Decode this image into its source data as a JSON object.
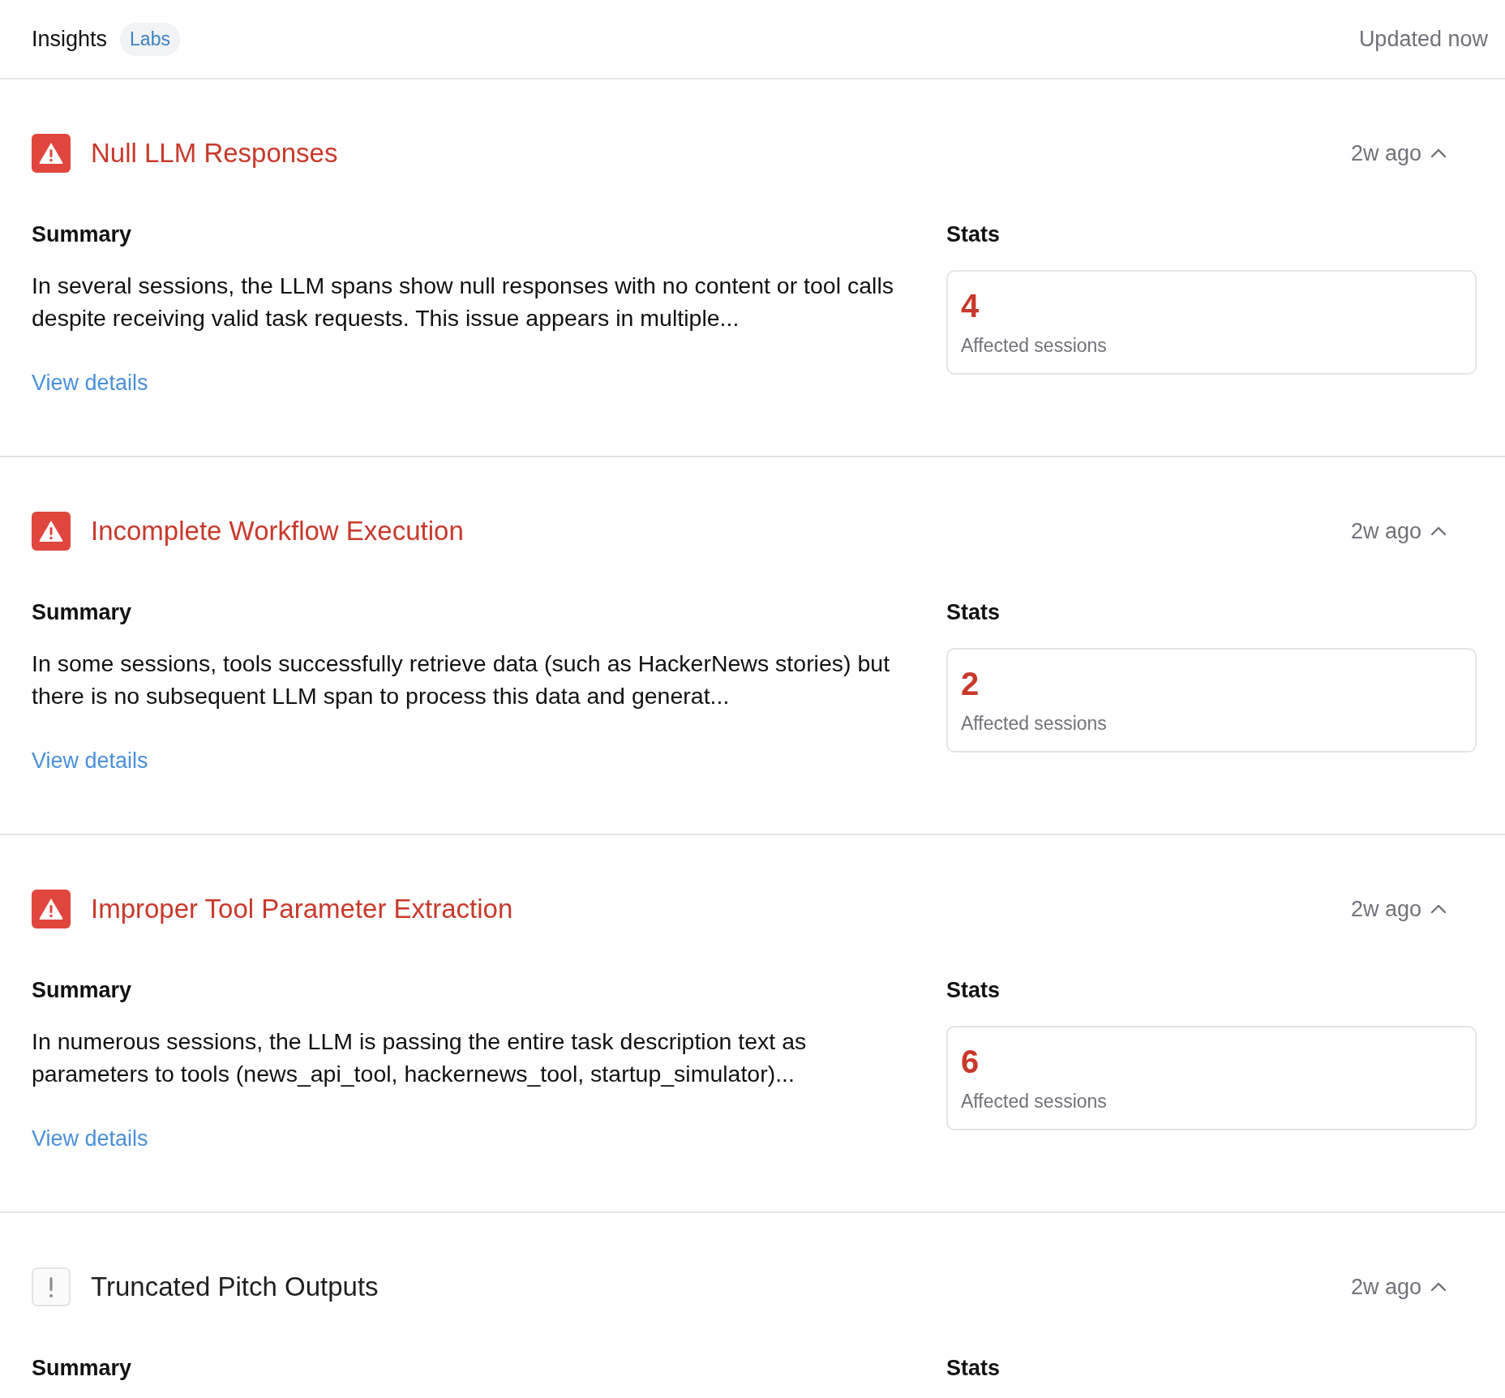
{
  "header": {
    "title": "Insights",
    "badge": "Labs",
    "status": "Updated now"
  },
  "insights": [
    {
      "kind": "warning",
      "title": "Null LLM Responses",
      "time": "2w ago",
      "expanded": true,
      "summary_label": "Summary",
      "summary": "In several sessions, the LLM spans show null responses with no content or tool calls despite receiving valid task requests. This issue appears in multiple...",
      "link": "View details",
      "stats_label": "Stats",
      "count": "4",
      "count_label": "Affected sessions"
    },
    {
      "kind": "warning",
      "title": "Incomplete Workflow Execution",
      "time": "2w ago",
      "expanded": true,
      "summary_label": "Summary",
      "summary": "In some sessions, tools successfully retrieve data (such as HackerNews stories) but there is no subsequent LLM span to process this data and generat...",
      "link": "View details",
      "stats_label": "Stats",
      "count": "2",
      "count_label": "Affected sessions"
    },
    {
      "kind": "warning",
      "title": "Improper Tool Parameter Extraction",
      "time": "2w ago",
      "expanded": true,
      "summary_label": "Summary",
      "summary": "In numerous sessions, the LLM is passing the entire task description text as parameters to tools (news_api_tool, hackernews_tool, startup_simulator)...",
      "link": "View details",
      "stats_label": "Stats",
      "count": "6",
      "count_label": "Affected sessions"
    },
    {
      "kind": "notice",
      "title": "Truncated Pitch Outputs",
      "time": "2w ago",
      "expanded": true,
      "summary_label": "Summary",
      "stats_label": "Stats"
    }
  ]
}
